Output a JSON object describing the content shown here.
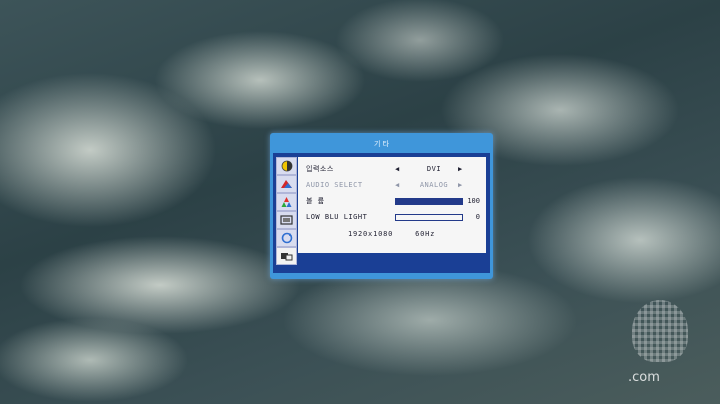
{
  "osd": {
    "title": "기 타",
    "tabs": [
      {
        "icon": "brightness-contrast-icon"
      },
      {
        "icon": "color-image-icon"
      },
      {
        "icon": "color-settings-icon"
      },
      {
        "icon": "osd-display-icon"
      },
      {
        "icon": "reset-icon"
      },
      {
        "icon": "other-settings-icon"
      }
    ],
    "rows": {
      "input_source": {
        "label": "입력소스",
        "value": "DVI"
      },
      "audio_select": {
        "label": "AUDIO SELECT",
        "value": "ANALOG"
      },
      "volume": {
        "label": "볼 륨",
        "value": "100",
        "level": 1.0
      },
      "low_blue_light": {
        "label": "LOW BLU LIGHT",
        "value": "0",
        "level": 0.0
      }
    },
    "info": {
      "resolution": "1920x1080",
      "refresh": "60Hz"
    },
    "arrows": {
      "left": "◀",
      "right": "▶"
    }
  },
  "watermark": {
    "text": ".com"
  },
  "colors": {
    "osd_bg": "#3f96da",
    "frame": "#1a3f95",
    "panel": "#f6f6f6"
  }
}
